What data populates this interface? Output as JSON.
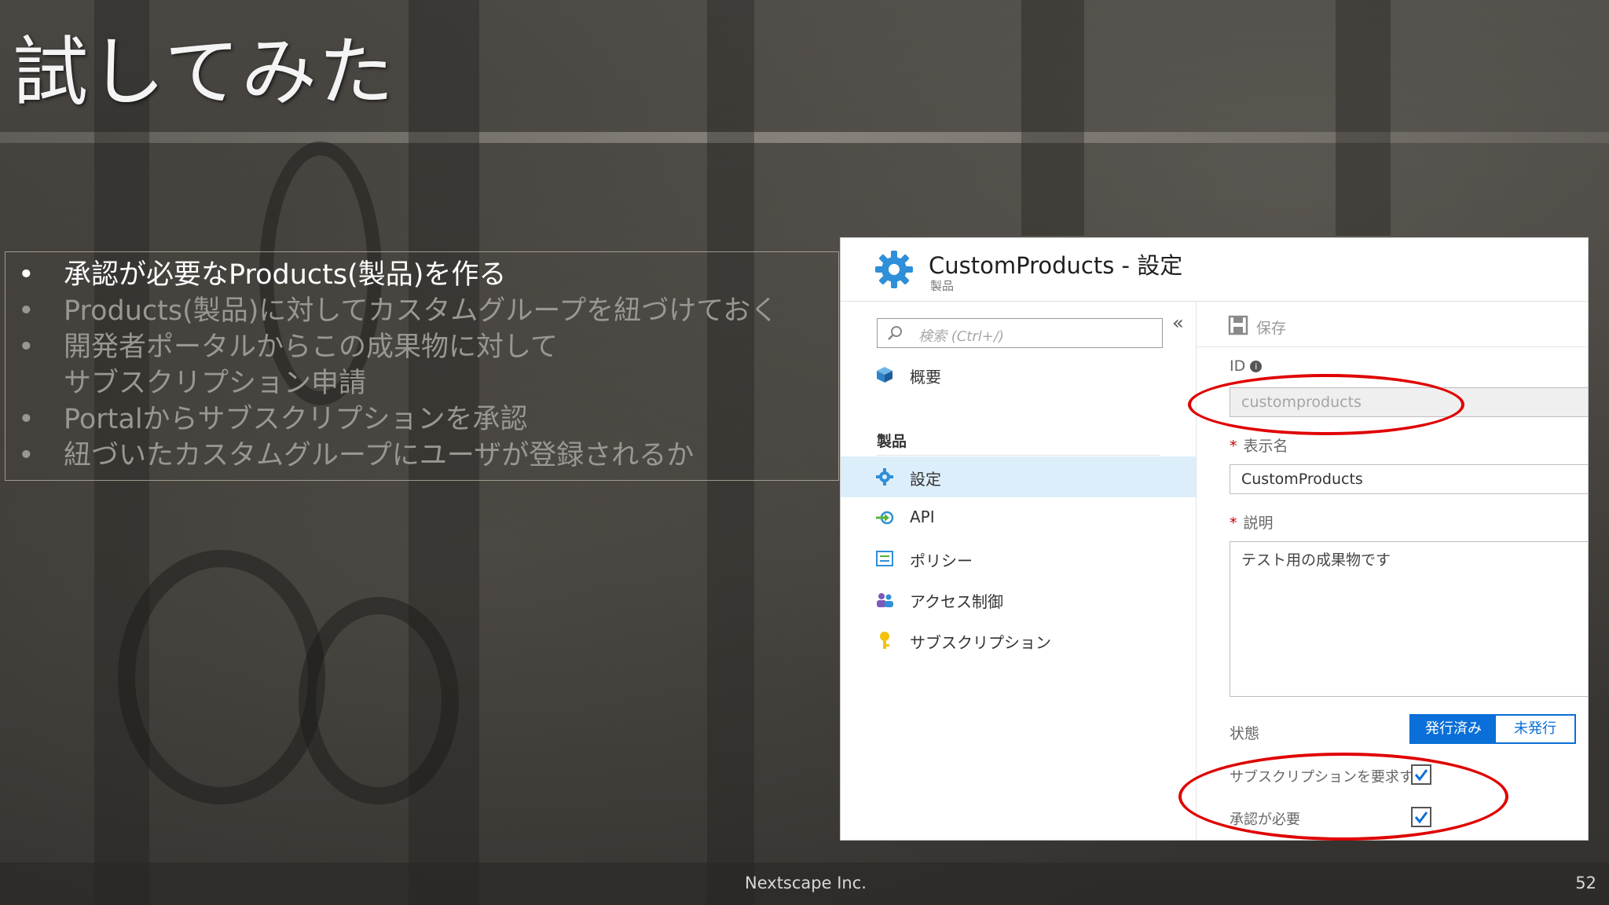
{
  "slide": {
    "title": "試してみた",
    "bullets": [
      "承認が必要なProducts(製品)を作る",
      "Products(製品)に対してカスタムグループを紐づけておく",
      "開発者ポータルからこの成果物に対して",
      "サブスクリプション申請",
      "Portalからサブスクリプションを承認",
      "紐づいたカスタムグループにユーザが登録されるか"
    ],
    "bullet_symbol": "•",
    "footer": {
      "company": "Nextscape Inc.",
      "page": "52"
    }
  },
  "panel": {
    "title": "CustomProducts - 設定",
    "subtitle": "製品",
    "search_placeholder": "検索 (Ctrl+/)",
    "collapse_glyph": "«",
    "menu": {
      "overview": "概要",
      "section": "製品",
      "settings": "設定",
      "api": "API",
      "policy": "ポリシー",
      "access": "アクセス制御",
      "subscription": "サブスクリプション"
    },
    "toolbar": {
      "save": "保存"
    },
    "form": {
      "id_label": "ID",
      "id_info_glyph": "i",
      "id_value": "customproducts",
      "required_mark": "*",
      "display_name_label": "表示名",
      "display_name_value": "CustomProducts",
      "description_label": "説明",
      "description_value": "テスト用の成果物です",
      "state_label": "状態",
      "state_on": "発行済み",
      "state_off": "未発行",
      "require_subscription_label": "サブスクリプションを要求する",
      "require_subscription_checked": true,
      "approval_required_label": "承認が必要",
      "approval_required_checked": true
    }
  },
  "colors": {
    "highlight_ellipse": "#e00000",
    "accent": "#0a6fd8",
    "selected_row": "#ddeefb",
    "required": "#c00000"
  }
}
